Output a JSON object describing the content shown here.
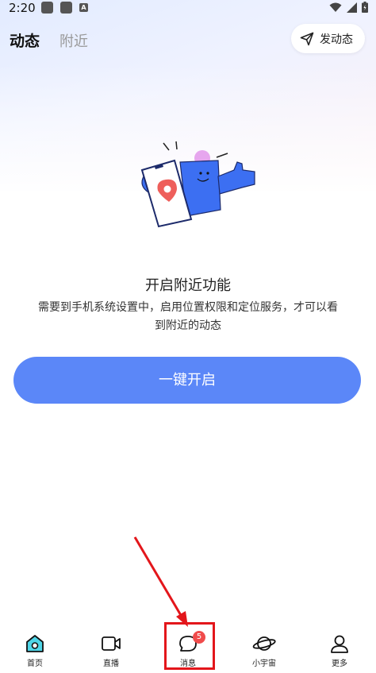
{
  "status_bar": {
    "time": "2:20",
    "notification_letter": "A"
  },
  "header": {
    "tabs": [
      {
        "label": "动态",
        "active": true
      },
      {
        "label": "附近",
        "active": false
      }
    ],
    "post_button_label": "发动态"
  },
  "empty_state": {
    "title": "开启附近功能",
    "description": "需要到手机系统设置中，启用位置权限和定位服务，才可以看到附近的动态",
    "button_label": "一键开启"
  },
  "bottom_nav": {
    "items": [
      {
        "label": "首页",
        "icon": "home-icon",
        "active": true
      },
      {
        "label": "直播",
        "icon": "video-camera-icon",
        "active": false
      },
      {
        "label": "消息",
        "icon": "chat-bubble-icon",
        "active": false,
        "badge": "5"
      },
      {
        "label": "小宇宙",
        "icon": "planet-icon",
        "active": false
      },
      {
        "label": "更多",
        "icon": "person-icon",
        "active": false
      }
    ]
  },
  "colors": {
    "accent": "#5b87f8",
    "badge": "#f04b4b",
    "annotation": "#e3161b",
    "home_active": "#4fd6e8"
  }
}
